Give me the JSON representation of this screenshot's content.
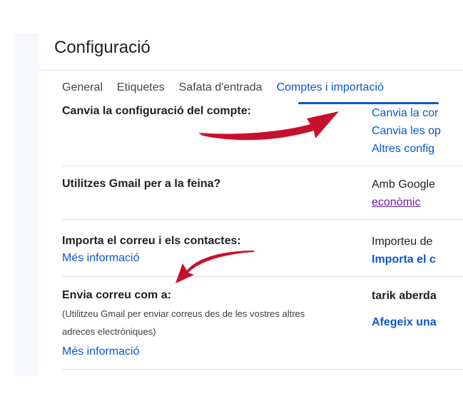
{
  "page": {
    "title": "Configuració"
  },
  "tabs": [
    {
      "label": "General",
      "active": false
    },
    {
      "label": "Etiquetes",
      "active": false
    },
    {
      "label": "Safata d'entrada",
      "active": false
    },
    {
      "label": "Comptes i importació",
      "active": true
    }
  ],
  "sections": {
    "account_settings": {
      "label": "Canvia la configuració del compte:",
      "links": [
        "Canvia la cor",
        "Canvia les op",
        "Altres config"
      ]
    },
    "work": {
      "label": "Utilitzes Gmail per a la feina?",
      "text": "Amb Google",
      "link": "econòmic"
    },
    "import": {
      "label": "Importa el correu i els contactes:",
      "learn_more": "Més informació",
      "text": "Importeu de",
      "link": "Importa el c"
    },
    "send_as": {
      "label": "Envia correu com a:",
      "note_line1": "(Utilitzeu Gmail per enviar correus des de les vostres altres",
      "note_line2": "adreces electròniques)",
      "learn_more": "Més informació",
      "account": "tarik aberda",
      "link": "Afegeix una"
    }
  },
  "colors": {
    "accent_blue": "#0b57d0",
    "annotation_red": "#c8102e",
    "visited_purple": "#681da8"
  },
  "icons": {
    "annotation_arrows": [
      "curved-arrow-up-right-icon",
      "curved-arrow-down-left-icon"
    ]
  }
}
